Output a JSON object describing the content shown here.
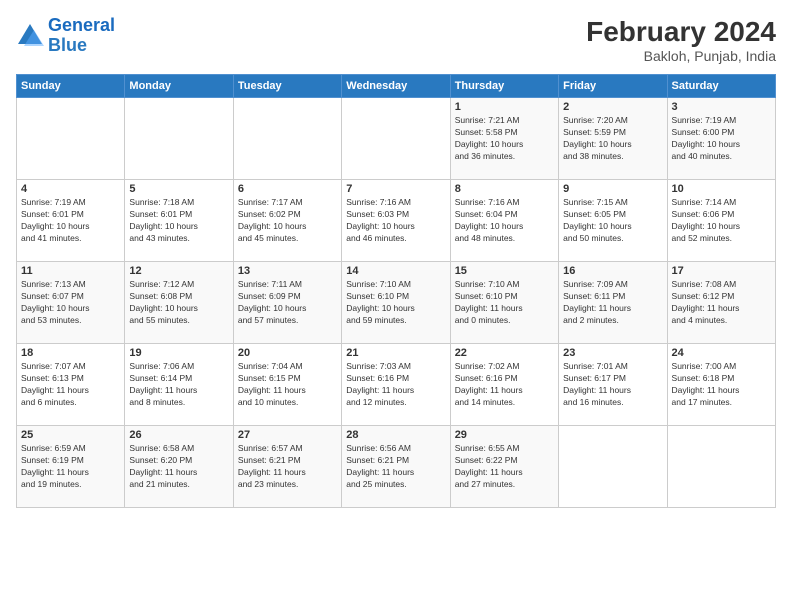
{
  "logo": {
    "line1": "General",
    "line2": "Blue"
  },
  "title": "February 2024",
  "subtitle": "Bakloh, Punjab, India",
  "days_of_week": [
    "Sunday",
    "Monday",
    "Tuesday",
    "Wednesday",
    "Thursday",
    "Friday",
    "Saturday"
  ],
  "weeks": [
    [
      {
        "day": "",
        "info": ""
      },
      {
        "day": "",
        "info": ""
      },
      {
        "day": "",
        "info": ""
      },
      {
        "day": "",
        "info": ""
      },
      {
        "day": "1",
        "info": "Sunrise: 7:21 AM\nSunset: 5:58 PM\nDaylight: 10 hours\nand 36 minutes."
      },
      {
        "day": "2",
        "info": "Sunrise: 7:20 AM\nSunset: 5:59 PM\nDaylight: 10 hours\nand 38 minutes."
      },
      {
        "day": "3",
        "info": "Sunrise: 7:19 AM\nSunset: 6:00 PM\nDaylight: 10 hours\nand 40 minutes."
      }
    ],
    [
      {
        "day": "4",
        "info": "Sunrise: 7:19 AM\nSunset: 6:01 PM\nDaylight: 10 hours\nand 41 minutes."
      },
      {
        "day": "5",
        "info": "Sunrise: 7:18 AM\nSunset: 6:01 PM\nDaylight: 10 hours\nand 43 minutes."
      },
      {
        "day": "6",
        "info": "Sunrise: 7:17 AM\nSunset: 6:02 PM\nDaylight: 10 hours\nand 45 minutes."
      },
      {
        "day": "7",
        "info": "Sunrise: 7:16 AM\nSunset: 6:03 PM\nDaylight: 10 hours\nand 46 minutes."
      },
      {
        "day": "8",
        "info": "Sunrise: 7:16 AM\nSunset: 6:04 PM\nDaylight: 10 hours\nand 48 minutes."
      },
      {
        "day": "9",
        "info": "Sunrise: 7:15 AM\nSunset: 6:05 PM\nDaylight: 10 hours\nand 50 minutes."
      },
      {
        "day": "10",
        "info": "Sunrise: 7:14 AM\nSunset: 6:06 PM\nDaylight: 10 hours\nand 52 minutes."
      }
    ],
    [
      {
        "day": "11",
        "info": "Sunrise: 7:13 AM\nSunset: 6:07 PM\nDaylight: 10 hours\nand 53 minutes."
      },
      {
        "day": "12",
        "info": "Sunrise: 7:12 AM\nSunset: 6:08 PM\nDaylight: 10 hours\nand 55 minutes."
      },
      {
        "day": "13",
        "info": "Sunrise: 7:11 AM\nSunset: 6:09 PM\nDaylight: 10 hours\nand 57 minutes."
      },
      {
        "day": "14",
        "info": "Sunrise: 7:10 AM\nSunset: 6:10 PM\nDaylight: 10 hours\nand 59 minutes."
      },
      {
        "day": "15",
        "info": "Sunrise: 7:10 AM\nSunset: 6:10 PM\nDaylight: 11 hours\nand 0 minutes."
      },
      {
        "day": "16",
        "info": "Sunrise: 7:09 AM\nSunset: 6:11 PM\nDaylight: 11 hours\nand 2 minutes."
      },
      {
        "day": "17",
        "info": "Sunrise: 7:08 AM\nSunset: 6:12 PM\nDaylight: 11 hours\nand 4 minutes."
      }
    ],
    [
      {
        "day": "18",
        "info": "Sunrise: 7:07 AM\nSunset: 6:13 PM\nDaylight: 11 hours\nand 6 minutes."
      },
      {
        "day": "19",
        "info": "Sunrise: 7:06 AM\nSunset: 6:14 PM\nDaylight: 11 hours\nand 8 minutes."
      },
      {
        "day": "20",
        "info": "Sunrise: 7:04 AM\nSunset: 6:15 PM\nDaylight: 11 hours\nand 10 minutes."
      },
      {
        "day": "21",
        "info": "Sunrise: 7:03 AM\nSunset: 6:16 PM\nDaylight: 11 hours\nand 12 minutes."
      },
      {
        "day": "22",
        "info": "Sunrise: 7:02 AM\nSunset: 6:16 PM\nDaylight: 11 hours\nand 14 minutes."
      },
      {
        "day": "23",
        "info": "Sunrise: 7:01 AM\nSunset: 6:17 PM\nDaylight: 11 hours\nand 16 minutes."
      },
      {
        "day": "24",
        "info": "Sunrise: 7:00 AM\nSunset: 6:18 PM\nDaylight: 11 hours\nand 17 minutes."
      }
    ],
    [
      {
        "day": "25",
        "info": "Sunrise: 6:59 AM\nSunset: 6:19 PM\nDaylight: 11 hours\nand 19 minutes."
      },
      {
        "day": "26",
        "info": "Sunrise: 6:58 AM\nSunset: 6:20 PM\nDaylight: 11 hours\nand 21 minutes."
      },
      {
        "day": "27",
        "info": "Sunrise: 6:57 AM\nSunset: 6:21 PM\nDaylight: 11 hours\nand 23 minutes."
      },
      {
        "day": "28",
        "info": "Sunrise: 6:56 AM\nSunset: 6:21 PM\nDaylight: 11 hours\nand 25 minutes."
      },
      {
        "day": "29",
        "info": "Sunrise: 6:55 AM\nSunset: 6:22 PM\nDaylight: 11 hours\nand 27 minutes."
      },
      {
        "day": "",
        "info": ""
      },
      {
        "day": "",
        "info": ""
      }
    ]
  ]
}
